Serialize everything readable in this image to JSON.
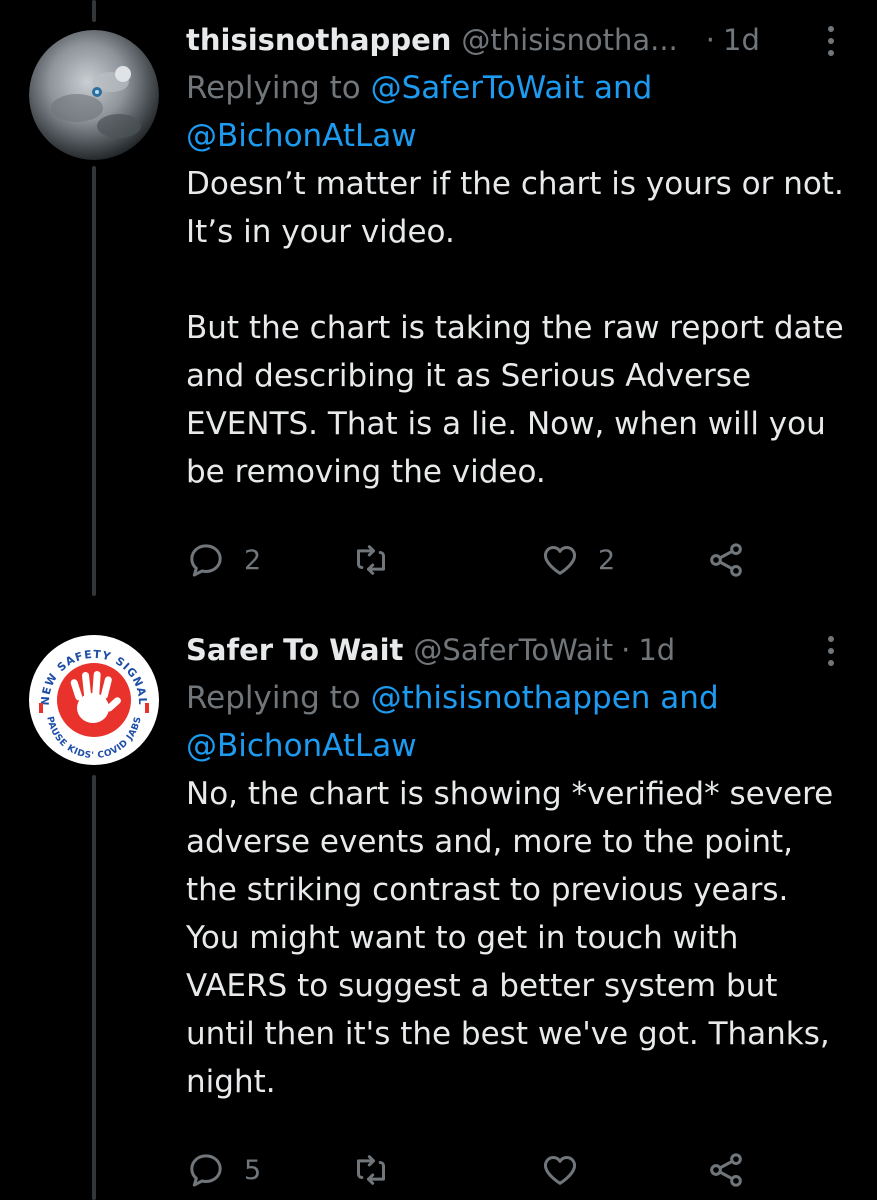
{
  "tweets": [
    {
      "display_name": "thisisnothappen",
      "handle": "@thisisnotha...",
      "separator": "·",
      "time": "1d",
      "replying_prefix": "Replying to ",
      "replying_line1_link": "@SaferToWait and",
      "replying_line2_link": "@BichonAtLaw",
      "paragraphs": [
        "Doesn’t matter if the chart is yours or not. It’s in your video.",
        "But the chart is taking the raw report date and describing it as Serious Adverse EVENTS. That is a lie. Now, when will you be removing the video."
      ],
      "reply_count": "2",
      "retweet_count": "",
      "like_count": "2",
      "avatar_icon": "moon-surface-avatar"
    },
    {
      "display_name": "Safer To Wait",
      "handle": "@SaferToWait",
      "separator": "·",
      "time": "1d",
      "replying_prefix": "Replying to ",
      "replying_line1_link": "@thisisnothappen and",
      "replying_line2_link": "@BichonAtLaw",
      "paragraphs": [
        "No, the chart is showing *verified* severe adverse events and, more to the point, the striking contrast to previous years. You might want to get in touch with VAERS to suggest a better system but until then it's the best we've got. Thanks, night."
      ],
      "reply_count": "5",
      "retweet_count": "",
      "like_count": "",
      "avatar_top_text": "NEW SAFETY SIGNAL",
      "avatar_bottom_text": "PAUSE KIDS' COVID JABS",
      "avatar_icon": "red-hand-avatar"
    }
  ],
  "icons": {
    "reply": "reply-icon",
    "retweet": "retweet-icon",
    "like": "heart-icon",
    "share": "share-icon",
    "more": "more-icon"
  },
  "colors": {
    "background": "#000000",
    "text": "#e7e9ea",
    "secondary": "#71767b",
    "link": "#1d9bf0",
    "thread_line": "#333639",
    "badge_red": "#e8322b"
  }
}
